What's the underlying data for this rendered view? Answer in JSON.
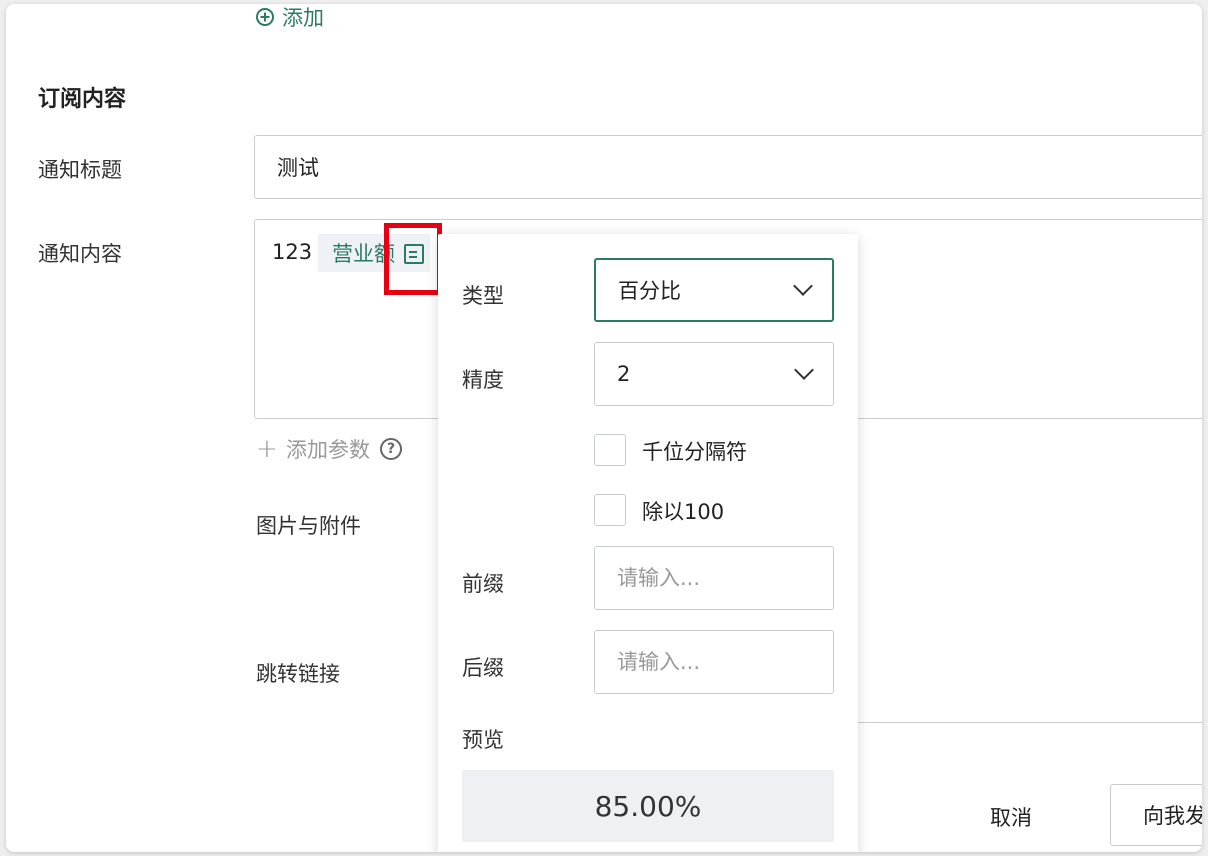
{
  "top": {
    "add_label": "添加"
  },
  "section": {
    "title": "订阅内容"
  },
  "form": {
    "notify_title_label": "通知标题",
    "notify_title_value": "测试",
    "notify_content_label": "通知内容",
    "content_text": "123",
    "param_chip_label": "营业额",
    "add_param_label": "添加参数",
    "images_attachments_label": "图片与附件",
    "jump_link_label": "跳转链接"
  },
  "footer": {
    "cancel_label": "取消",
    "send_label": "向我发送"
  },
  "popup": {
    "type_label": "类型",
    "type_value": "百分比",
    "precision_label": "精度",
    "precision_value": "2",
    "thousands_sep_label": "千位分隔符",
    "divide_100_label": "除以100",
    "prefix_label": "前缀",
    "prefix_placeholder": "请输入...",
    "suffix_label": "后缀",
    "suffix_placeholder": "请输入...",
    "preview_label": "预览",
    "preview_value": "85.00%"
  },
  "colors": {
    "accent": "#2b7a66",
    "highlight": "#e60012",
    "border": "#c9cdd2"
  },
  "icons": {
    "add": "plus-circle-icon",
    "edit": "edit-icon",
    "add_param": "plus-icon",
    "help": "help-circle-icon",
    "dropdown": "chevron-down-icon"
  }
}
